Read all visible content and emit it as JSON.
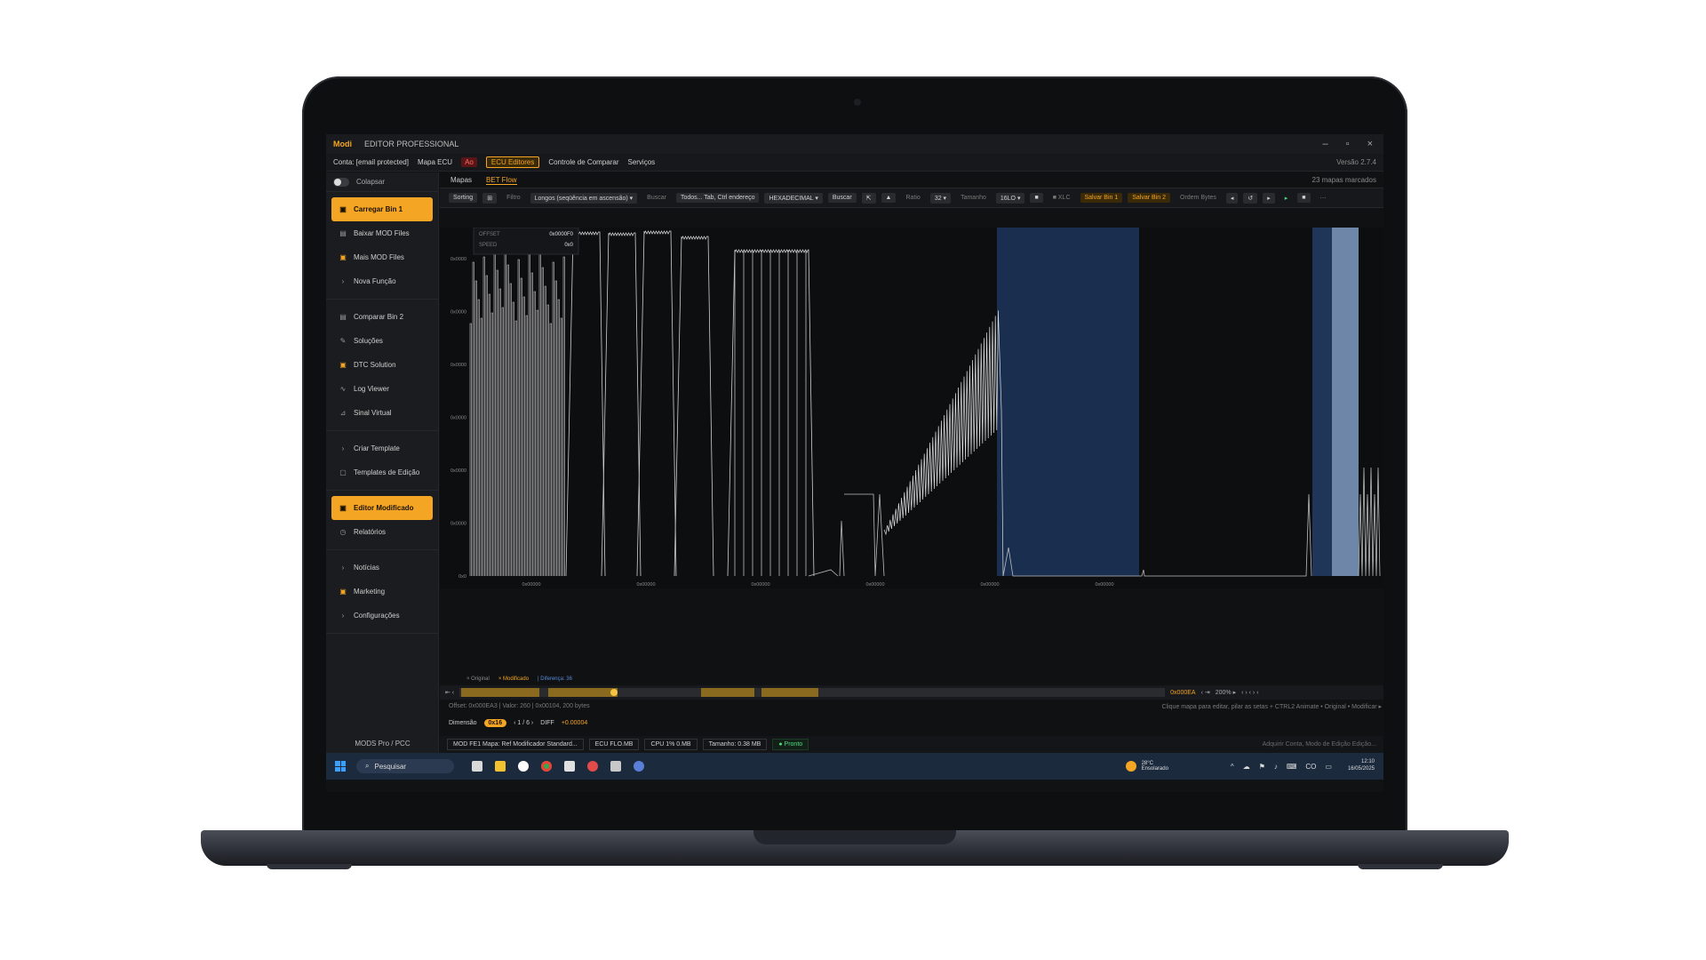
{
  "app": {
    "brand": "Modi",
    "title": "EDITOR PROFESSIONAL",
    "window_controls": [
      "–",
      "▫",
      "×"
    ]
  },
  "menubar": {
    "account": "Conta: [email protected]",
    "items": [
      {
        "label": "Mapa ECU",
        "style": "normal"
      },
      {
        "label": "Ao",
        "style": "red"
      },
      {
        "label": "ECU Editores",
        "style": "hl"
      },
      {
        "label": "Controle de Comparar",
        "style": "normal"
      },
      {
        "label": "Serviços",
        "style": "normal"
      }
    ],
    "version": "Versão 2.7.4"
  },
  "sidebar": {
    "collapse_label": "Colapsar",
    "groups": [
      [
        {
          "label": "Carregar Bin 1",
          "icon": "file-icon",
          "glyph": "▣",
          "active": true
        },
        {
          "label": "Baixar MOD Files",
          "icon": "download-icon",
          "glyph": "▤",
          "active": false
        },
        {
          "label": "Mais MOD Files",
          "icon": "folder-icon",
          "glyph": "▣",
          "active": false,
          "orange": true
        },
        {
          "label": "Nova Função",
          "icon": "plus-icon",
          "glyph": "›",
          "active": false
        }
      ],
      [
        {
          "label": "Comparar Bin 2",
          "icon": "compare-icon",
          "glyph": "▤",
          "active": false
        },
        {
          "label": "Soluções",
          "icon": "wrench-icon",
          "glyph": "✎",
          "active": false
        },
        {
          "label": "DTC Solution",
          "icon": "alert-icon",
          "glyph": "▣",
          "active": false,
          "orange": true
        },
        {
          "label": "Log Viewer",
          "icon": "wave-icon",
          "glyph": "∿",
          "active": false
        },
        {
          "label": "Sinal Virtual",
          "icon": "signal-icon",
          "glyph": "⊿",
          "active": false
        }
      ],
      [
        {
          "label": "Criar Template",
          "icon": "template-icon",
          "glyph": "›",
          "active": false
        },
        {
          "label": "Templates de Edição",
          "icon": "document-icon",
          "glyph": "▢",
          "active": false
        }
      ],
      [
        {
          "label": "Editor Modificado",
          "icon": "edit-icon",
          "glyph": "▣",
          "active": true
        },
        {
          "label": "Relatórios",
          "icon": "report-icon",
          "glyph": "◷",
          "active": false
        }
      ],
      [
        {
          "label": "Notícias",
          "icon": "news-icon",
          "glyph": "›",
          "active": false
        },
        {
          "label": "Marketing",
          "icon": "marketing-icon",
          "glyph": "▣",
          "active": false,
          "orange": true
        },
        {
          "label": "Configurações",
          "icon": "gear-icon",
          "glyph": "›",
          "active": false
        }
      ]
    ],
    "footer": "MODS Pro / PCC"
  },
  "main": {
    "tabs": [
      {
        "label": "Mapas",
        "active": false
      },
      {
        "label": "BET Flow",
        "active": true
      }
    ],
    "count_label": "23 mapas marcados",
    "toolbar": [
      {
        "label": "Sorting",
        "style": "normal"
      },
      {
        "label": "⊞",
        "style": "normal"
      },
      {
        "label": "Filtro",
        "style": "dim"
      },
      {
        "label": "Longos (seqüência em ascensão) ▾",
        "style": "normal"
      },
      {
        "label": "Buscar",
        "style": "dim"
      },
      {
        "label": "Todos... Tab, Ctrl endereço",
        "style": "normal"
      },
      {
        "label": "HEXADECIMAL ▾",
        "style": "normal"
      },
      {
        "label": "Buscar",
        "style": "normal"
      },
      {
        "label": "⇱",
        "style": "normal"
      },
      {
        "label": "▲",
        "style": "normal"
      },
      {
        "label": "Ratio",
        "style": "dim"
      },
      {
        "label": "32 ▾",
        "style": "normal"
      },
      {
        "label": "Tamanho",
        "style": "dim"
      },
      {
        "label": "16LO ▾",
        "style": "normal"
      },
      {
        "label": "■",
        "style": "normal"
      },
      {
        "label": "■ XLC",
        "style": "dim"
      },
      {
        "label": "Salvar Bin 1",
        "style": "orange"
      },
      {
        "label": "Salvar Bin 2",
        "style": "orange"
      },
      {
        "label": "Ordem Bytes",
        "style": "dim"
      },
      {
        "label": "◂",
        "style": "normal"
      },
      {
        "label": "↺",
        "style": "normal"
      },
      {
        "label": "▸",
        "style": "normal"
      },
      {
        "label": "▸",
        "style": "green"
      },
      {
        "label": "■",
        "style": "normal"
      },
      {
        "label": "⋯",
        "style": "dim"
      }
    ],
    "plot": {
      "y_ticks": [
        "0x0000",
        "0x0000",
        "0x0000",
        "0x0000",
        "0x0000",
        "0x0000",
        "0x0"
      ],
      "x_ticks": [
        "0x00000",
        "0x00000",
        "0x00000",
        "0x00000",
        "0x00000",
        "0x00000"
      ],
      "tooltip": {
        "k1": "OFFSET",
        "v1": "0x0000F0",
        "k2": "SPEED",
        "v2": "0x0"
      },
      "legend": [
        "× Original",
        "× Modificado",
        "| Diferença: 36"
      ]
    },
    "scroll": {
      "left": "⇤  ‹",
      "value": "0x000EA",
      "mid": "‹  ⇥",
      "zoom": "200% ▸",
      "nav": "‹ › ‹ › ‹"
    },
    "info": {
      "left": "Offset: 0x000EA3 | Valor: 260 | 0x00104, 200 bytes",
      "hint": "Clique mapa para editar, pilar as setas + CTRL2 Animate • Original • Modificar ▸"
    },
    "dimension": {
      "label": "Dimensão",
      "badge": "0x16",
      "nav": "‹  1 / 6  ›",
      "diff": "DIFF",
      "diff_value": "+0.00004"
    },
    "status": [
      {
        "label": "MOD FE1  Mapa: Ref Modificador Standard...",
        "style": "normal"
      },
      {
        "label": "ECU FLO.MB",
        "style": "normal"
      },
      {
        "label": "CPU 1% 0.MB",
        "style": "normal"
      },
      {
        "label": "Tamanho: 0.38 MB",
        "style": "normal"
      },
      {
        "label": "● Pronto",
        "style": "green"
      }
    ],
    "status_right": "Adquirir Conta, Modo de Edição Edição..."
  },
  "taskbar": {
    "search_placeholder": "Pesquisar",
    "weather_line1": "28°C",
    "weather_line2": "Ensolarado",
    "tray_icons": [
      "^",
      "☁",
      "⚑",
      "♪",
      "⌨",
      "CO",
      "▭"
    ],
    "time": "12:10",
    "date": "16/05/2025"
  },
  "colors": {
    "accent": "#f5a524",
    "highlight_band": "#1a2f50",
    "highlight_band_light": "#6e86a8",
    "trace": "#d0d0d0",
    "taskbar": "#1c2a3d"
  }
}
